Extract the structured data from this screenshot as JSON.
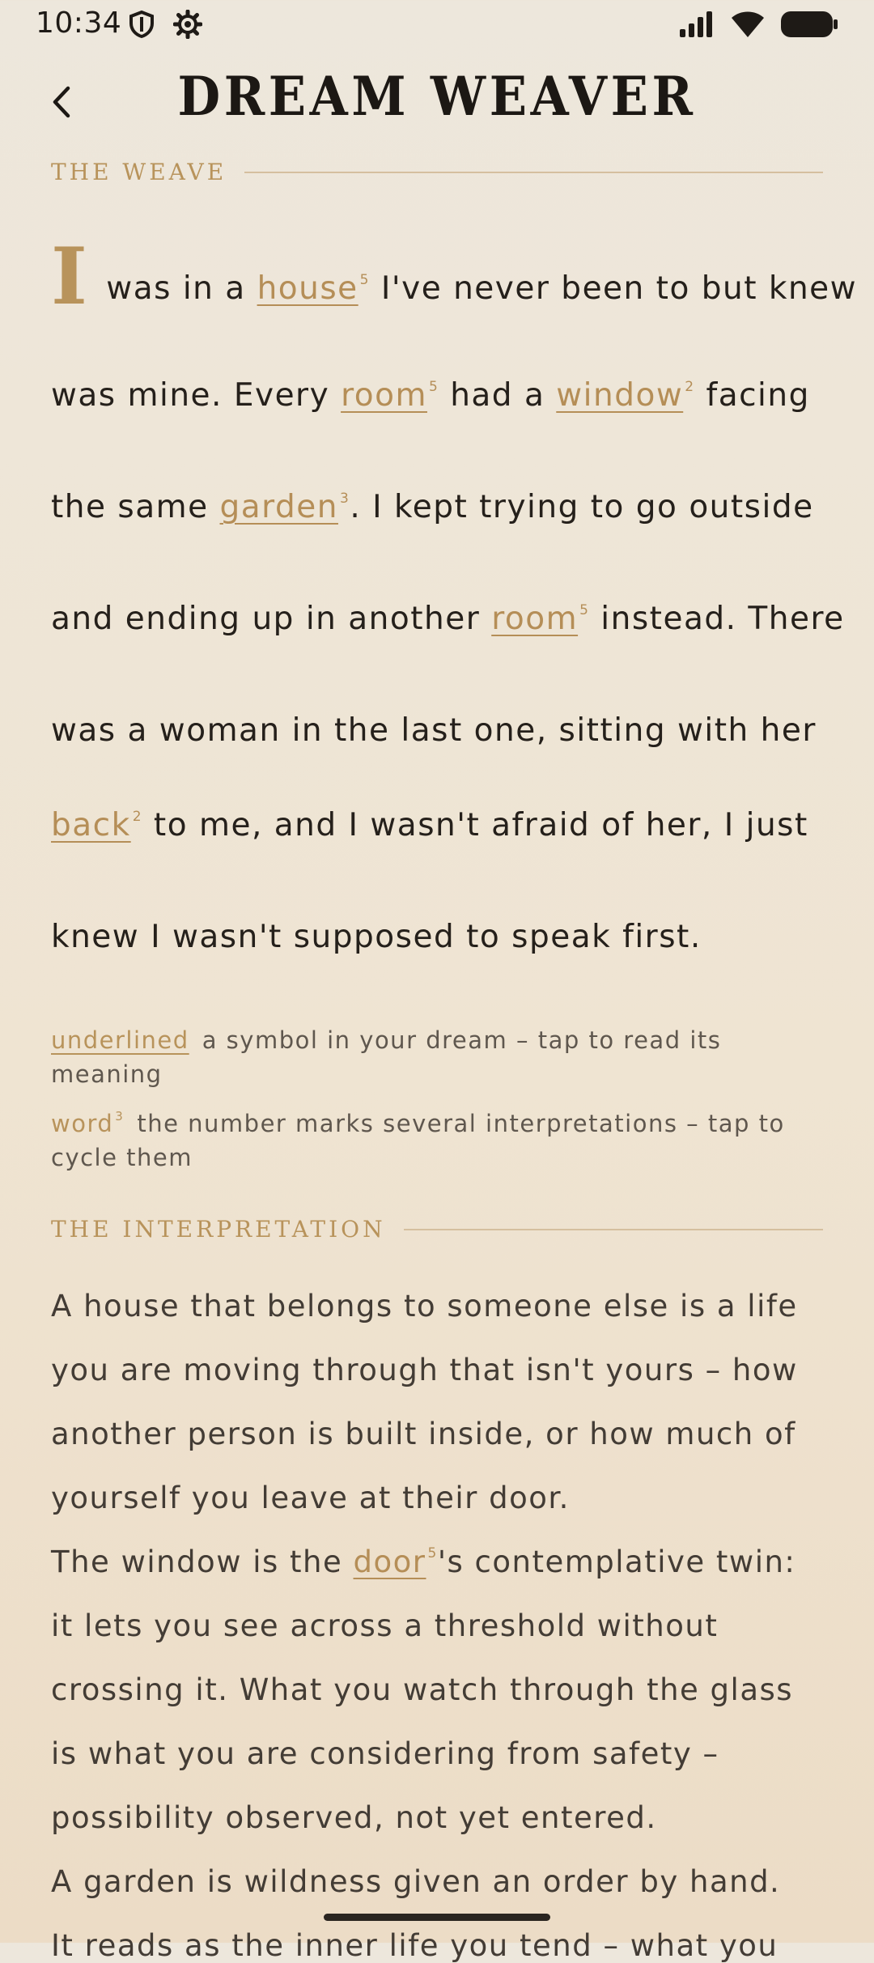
{
  "status": {
    "time": "10:34"
  },
  "header": {
    "title": "DREAM WEAVER"
  },
  "weave": {
    "section_label": "THE WEAVE",
    "drop_cap": "I",
    "line1": {
      "pre": " was in a ",
      "sym": "house",
      "sup": "5",
      "post": " I've never been to but knew"
    },
    "line2": {
      "pre": "was mine. Every ",
      "sym1": "room",
      "sup1": "5",
      "mid": " had a ",
      "sym2": "window",
      "sup2": "2",
      "post": " facing"
    },
    "line3": {
      "pre": "the same ",
      "sym": "garden",
      "sup": "3",
      "post": ". I kept trying to go outside"
    },
    "line4": {
      "pre": "and ending up in another ",
      "sym": "room",
      "sup": "5",
      "post": " instead. There"
    },
    "line5": {
      "text": "was a woman in the last one, sitting with her"
    },
    "line6": {
      "sym": "back",
      "sup": "2",
      "post": " to me, and I wasn't afraid of her, I just"
    },
    "line7": {
      "text": "knew I wasn't supposed to speak first."
    }
  },
  "legend": {
    "underlined_key": "underlined",
    "underlined_desc": "a symbol in your dream – tap to read its meaning",
    "word_key": "word",
    "word_sup": "3",
    "word_desc": "the number marks several interpretations – tap to cycle them"
  },
  "interpretation": {
    "section_label": "THE INTERPRETATION",
    "l1": "A house that belongs to someone else is a life",
    "l2": "you are moving through that isn't yours – how",
    "l3": "another person is built inside, or how much of",
    "l4": "yourself you leave at their door.",
    "l5": {
      "pre": "The window is the ",
      "sym": "door",
      "sup": "5",
      "post": "'s contemplative twin:"
    },
    "l6": "it lets you see across a threshold without",
    "l7": "crossing it. What you watch through the glass",
    "l8": "is what you are considering from safety –",
    "l9": "possibility observed, not yet entered.",
    "l10": "A garden is wildness given an order by hand.",
    "l11": "It reads as the inner life you tend – what you"
  }
}
